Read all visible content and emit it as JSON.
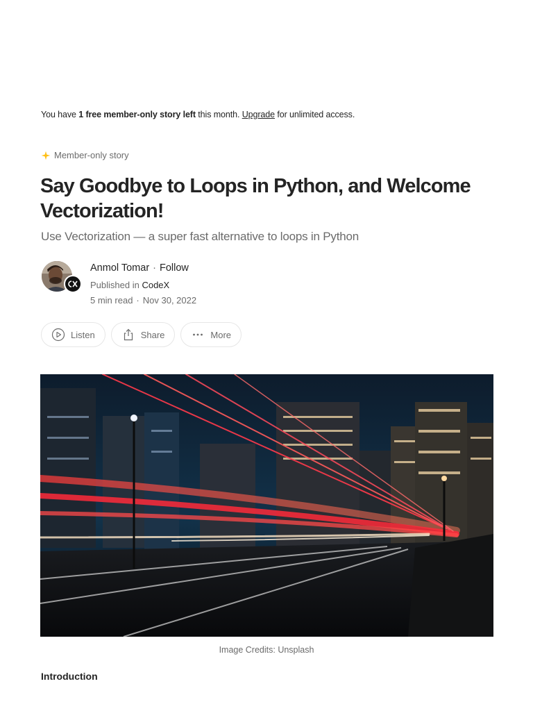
{
  "notice": {
    "prefix": "You have ",
    "highlight": "1 free member-only story left",
    "middle": " this month. ",
    "link": "Upgrade",
    "suffix": " for unlimited access."
  },
  "member_only_label": "Member-only story",
  "article": {
    "title": "Say Goodbye to Loops in Python, and Welcome Vectorization!",
    "subtitle": "Use Vectorization — a super fast alternative to loops in Python"
  },
  "author": {
    "name": "Anmol Tomar",
    "separator": "·",
    "follow_label": "Follow",
    "published_prefix": "Published in ",
    "publication": "CodeX",
    "read_time": "5 min read",
    "date": "Nov 30, 2022"
  },
  "actions": {
    "listen_label": "Listen",
    "share_label": "Share",
    "more_label": "More"
  },
  "icons": {
    "star": "sparkle-star-icon",
    "listen": "play-circle-icon",
    "share": "share-upload-icon",
    "more": "more-dots-icon"
  },
  "colors": {
    "accent_star": "#ffc017",
    "text_primary": "#242424",
    "text_secondary": "#6b6b6b"
  },
  "hero": {
    "caption": "Image Credits: Unsplash"
  },
  "body": {
    "first_heading": "Introduction"
  }
}
